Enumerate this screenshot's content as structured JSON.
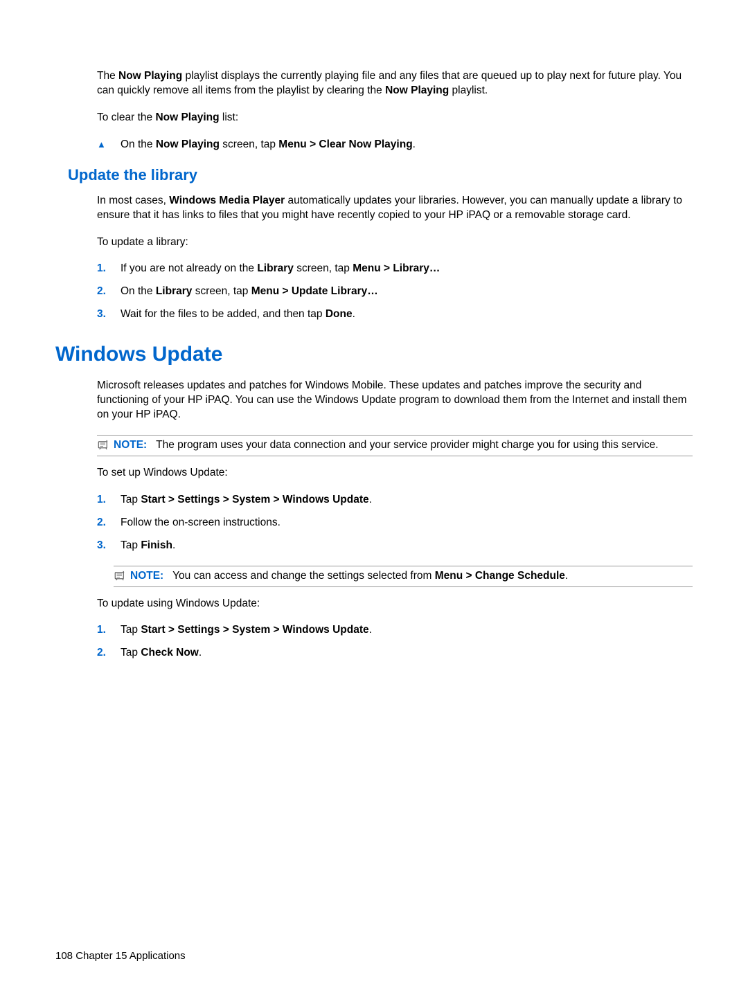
{
  "p1_a": "The ",
  "p1_b": "Now Playing",
  "p1_c": " playlist displays the currently playing file and any files that are queued up to play next for future play. You can quickly remove all items from the playlist by clearing the ",
  "p1_d": "Now Playing",
  "p1_e": " playlist.",
  "p2_a": "To clear the ",
  "p2_b": "Now Playing",
  "p2_c": " list:",
  "step_a_a": "On the ",
  "step_a_b": "Now Playing",
  "step_a_c": " screen, tap ",
  "step_a_d": "Menu > Clear Now Playing",
  "step_a_e": ".",
  "h2_1": "Update the library",
  "p3_a": "In most cases, ",
  "p3_b": "Windows Media Player",
  "p3_c": " automatically updates your libraries. However, you can manually update a library to ensure that it has links to files that you might have recently copied to your HP iPAQ or a removable storage card.",
  "p4": "To update a library:",
  "s1n": "1.",
  "s1_a": "If you are not already on the ",
  "s1_b": "Library",
  "s1_c": " screen, tap ",
  "s1_d": "Menu > Library…",
  "s2n": "2.",
  "s2_a": "On the ",
  "s2_b": "Library",
  "s2_c": " screen, tap ",
  "s2_d": "Menu > Update Library…",
  "s3n": "3.",
  "s3_a": "Wait for the files to be added, and then tap ",
  "s3_b": "Done",
  "s3_c": ".",
  "h1_1": "Windows Update",
  "p5": "Microsoft releases updates and patches for Windows Mobile. These updates and patches improve the security and functioning of your HP iPAQ. You can use the Windows Update program to download them from the Internet and install them on your HP iPAQ.",
  "note1_label": "NOTE:",
  "note1_text": "The program uses your data connection and your service provider might charge you for using this service.",
  "p6": "To set up Windows Update:",
  "t1n": "1.",
  "t1_a": "Tap ",
  "t1_b": "Start > Settings > System > Windows Update",
  "t1_c": ".",
  "t2n": "2.",
  "t2_a": "Follow the on-screen instructions.",
  "t3n": "3.",
  "t3_a": "Tap ",
  "t3_b": "Finish",
  "t3_c": ".",
  "note2_label": "NOTE:",
  "note2_a": "You can access and change the settings selected from ",
  "note2_b": "Menu > Change Schedule",
  "note2_c": ".",
  "p7": "To update using Windows Update:",
  "u1n": "1.",
  "u1_a": "Tap ",
  "u1_b": "Start > Settings > System > Windows Update",
  "u1_c": ".",
  "u2n": "2.",
  "u2_a": "Tap ",
  "u2_b": "Check Now",
  "u2_c": ".",
  "footer": "108   Chapter 15   Applications"
}
